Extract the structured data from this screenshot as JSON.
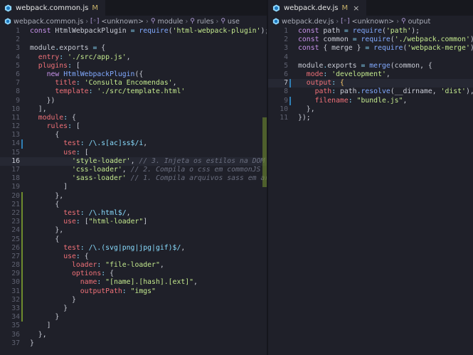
{
  "left": {
    "tab": {
      "name": "webpack.common.js",
      "status": "M",
      "close": "×"
    },
    "breadcrumb": [
      "webpack.common.js",
      "<unknown>",
      "module",
      "rules",
      "use"
    ],
    "active_line": 16,
    "lines": [
      {
        "n": "1",
        "parts": [
          [
            "k",
            "const "
          ],
          [
            "w",
            "HtmlWebpackPlugin "
          ],
          [
            "p",
            "= "
          ],
          [
            "f",
            "require"
          ],
          [
            "w",
            "("
          ],
          [
            "s",
            "'html-webpack-plugin'"
          ],
          [
            "w",
            ");"
          ]
        ]
      },
      {
        "n": "2",
        "parts": []
      },
      {
        "n": "3",
        "parts": [
          [
            "w",
            "module"
          ],
          [
            "p",
            "."
          ],
          [
            "w",
            "exports "
          ],
          [
            "p",
            "= "
          ],
          [
            "w",
            "{"
          ]
        ]
      },
      {
        "n": "4",
        "parts": [
          [
            "w",
            "  "
          ],
          [
            "pr",
            "entry"
          ],
          [
            "p",
            ": "
          ],
          [
            "s",
            "'./src/app.js'"
          ],
          [
            "w",
            ","
          ]
        ]
      },
      {
        "n": "5",
        "parts": [
          [
            "w",
            "  "
          ],
          [
            "pr",
            "plugins"
          ],
          [
            "p",
            ": "
          ],
          [
            "w",
            "["
          ]
        ]
      },
      {
        "n": "6",
        "parts": [
          [
            "w",
            "    "
          ],
          [
            "k",
            "new "
          ],
          [
            "f",
            "HtmlWebpackPlugin"
          ],
          [
            "w",
            "({"
          ]
        ]
      },
      {
        "n": "7",
        "parts": [
          [
            "w",
            "      "
          ],
          [
            "pr",
            "title"
          ],
          [
            "p",
            ": "
          ],
          [
            "s",
            "'Consulta Encomendas'"
          ],
          [
            "w",
            ","
          ]
        ]
      },
      {
        "n": "8",
        "parts": [
          [
            "w",
            "      "
          ],
          [
            "pr",
            "template"
          ],
          [
            "p",
            ": "
          ],
          [
            "s",
            "'./src/template.html'"
          ]
        ]
      },
      {
        "n": "9",
        "parts": [
          [
            "w",
            "    })"
          ]
        ]
      },
      {
        "n": "10",
        "parts": [
          [
            "w",
            "  ],"
          ]
        ]
      },
      {
        "n": "11",
        "parts": [
          [
            "w",
            "  "
          ],
          [
            "pr",
            "module"
          ],
          [
            "p",
            ": "
          ],
          [
            "w",
            "{"
          ]
        ]
      },
      {
        "n": "12",
        "parts": [
          [
            "w",
            "    "
          ],
          [
            "pr",
            "rules"
          ],
          [
            "p",
            ": "
          ],
          [
            "w",
            "["
          ]
        ]
      },
      {
        "n": "13",
        "parts": [
          [
            "w",
            "      {"
          ]
        ]
      },
      {
        "n": "14",
        "parts": [
          [
            "w",
            "        "
          ],
          [
            "pr",
            "test"
          ],
          [
            "p",
            ": "
          ],
          [
            "r",
            "/\\.s[ac]ss$/i"
          ],
          [
            "w",
            ","
          ]
        ]
      },
      {
        "n": "15",
        "parts": [
          [
            "w",
            "        "
          ],
          [
            "pr",
            "use"
          ],
          [
            "p",
            ": "
          ],
          [
            "w",
            "["
          ]
        ]
      },
      {
        "n": "16",
        "parts": [
          [
            "w",
            "          "
          ],
          [
            "s",
            "'style-loader'"
          ],
          [
            "w",
            ", "
          ],
          [
            "c",
            "// 3. Injeta os estilos na DOM"
          ]
        ]
      },
      {
        "n": "17",
        "parts": [
          [
            "w",
            "          "
          ],
          [
            "s",
            "'css-loader'"
          ],
          [
            "w",
            ", "
          ],
          [
            "c",
            "// 2. Compila o css em commonJS"
          ]
        ]
      },
      {
        "n": "18",
        "parts": [
          [
            "w",
            "          "
          ],
          [
            "s",
            "'sass-loader'"
          ],
          [
            "w",
            " "
          ],
          [
            "c",
            "// 1. Compila arquivos sass em arqui"
          ]
        ]
      },
      {
        "n": "19",
        "parts": [
          [
            "w",
            "        ]"
          ]
        ]
      },
      {
        "n": "20",
        "parts": [
          [
            "w",
            "      },"
          ]
        ]
      },
      {
        "n": "21",
        "parts": [
          [
            "w",
            "      {"
          ]
        ]
      },
      {
        "n": "22",
        "parts": [
          [
            "w",
            "        "
          ],
          [
            "pr",
            "test"
          ],
          [
            "p",
            ": "
          ],
          [
            "r",
            "/\\.html$/"
          ],
          [
            "w",
            ","
          ]
        ]
      },
      {
        "n": "23",
        "parts": [
          [
            "w",
            "        "
          ],
          [
            "pr",
            "use"
          ],
          [
            "p",
            ": "
          ],
          [
            "w",
            "["
          ],
          [
            "s",
            "\"html-loader\""
          ],
          [
            "w",
            "]"
          ]
        ]
      },
      {
        "n": "24",
        "parts": [
          [
            "w",
            "      },"
          ]
        ]
      },
      {
        "n": "25",
        "parts": [
          [
            "w",
            "      {"
          ]
        ]
      },
      {
        "n": "26",
        "parts": [
          [
            "w",
            "        "
          ],
          [
            "pr",
            "test"
          ],
          [
            "p",
            ": "
          ],
          [
            "r",
            "/\\.(svg|png|jpg|gif)$/"
          ],
          [
            "w",
            ","
          ]
        ]
      },
      {
        "n": "27",
        "parts": [
          [
            "w",
            "        "
          ],
          [
            "pr",
            "use"
          ],
          [
            "p",
            ": "
          ],
          [
            "w",
            "{"
          ]
        ]
      },
      {
        "n": "28",
        "parts": [
          [
            "w",
            "          "
          ],
          [
            "pr",
            "loader"
          ],
          [
            "p",
            ": "
          ],
          [
            "s",
            "\"file-loader\""
          ],
          [
            "w",
            ","
          ]
        ]
      },
      {
        "n": "29",
        "parts": [
          [
            "w",
            "          "
          ],
          [
            "pr",
            "options"
          ],
          [
            "p",
            ": "
          ],
          [
            "w",
            "{"
          ]
        ]
      },
      {
        "n": "30",
        "parts": [
          [
            "w",
            "            "
          ],
          [
            "pr",
            "name"
          ],
          [
            "p",
            ": "
          ],
          [
            "s",
            "\"[name].[hash].[ext]\""
          ],
          [
            "w",
            ","
          ]
        ]
      },
      {
        "n": "31",
        "parts": [
          [
            "w",
            "            "
          ],
          [
            "pr",
            "outputPath"
          ],
          [
            "p",
            ": "
          ],
          [
            "s",
            "\"imgs\""
          ]
        ]
      },
      {
        "n": "32",
        "parts": [
          [
            "w",
            "          }"
          ]
        ]
      },
      {
        "n": "33",
        "parts": [
          [
            "w",
            "        }"
          ]
        ]
      },
      {
        "n": "34",
        "parts": [
          [
            "w",
            "      }"
          ]
        ]
      },
      {
        "n": "35",
        "parts": [
          [
            "w",
            "    ]"
          ]
        ]
      },
      {
        "n": "36",
        "parts": [
          [
            "w",
            "  },"
          ]
        ]
      },
      {
        "n": "37",
        "parts": [
          [
            "w",
            "}"
          ]
        ]
      }
    ]
  },
  "right": {
    "tab": {
      "name": "webpack.dev.js",
      "status": "M",
      "close": "×"
    },
    "breadcrumb": [
      "webpack.dev.js",
      "<unknown>",
      "output"
    ],
    "active_line": 7,
    "lines": [
      {
        "n": "1",
        "parts": [
          [
            "k",
            "const "
          ],
          [
            "w",
            "path "
          ],
          [
            "p",
            "= "
          ],
          [
            "f",
            "require"
          ],
          [
            "w",
            "("
          ],
          [
            "s",
            "'path'"
          ],
          [
            "w",
            ");"
          ]
        ]
      },
      {
        "n": "2",
        "parts": [
          [
            "k",
            "const "
          ],
          [
            "w",
            "common "
          ],
          [
            "p",
            "= "
          ],
          [
            "f",
            "require"
          ],
          [
            "w",
            "("
          ],
          [
            "s",
            "'./webpack.common'"
          ],
          [
            "w",
            ");"
          ]
        ]
      },
      {
        "n": "3",
        "parts": [
          [
            "k",
            "const "
          ],
          [
            "w",
            "{ merge } "
          ],
          [
            "p",
            "= "
          ],
          [
            "f",
            "require"
          ],
          [
            "w",
            "("
          ],
          [
            "s",
            "'webpack-merge'"
          ],
          [
            "w",
            ");"
          ]
        ]
      },
      {
        "n": "4",
        "parts": []
      },
      {
        "n": "5",
        "parts": [
          [
            "w",
            "module"
          ],
          [
            "p",
            "."
          ],
          [
            "w",
            "exports "
          ],
          [
            "p",
            "= "
          ],
          [
            "f",
            "merge"
          ],
          [
            "w",
            "(common, {"
          ]
        ]
      },
      {
        "n": "6",
        "parts": [
          [
            "w",
            "  "
          ],
          [
            "pr",
            "mode"
          ],
          [
            "p",
            ": "
          ],
          [
            "s",
            "'development'"
          ],
          [
            "w",
            ","
          ]
        ]
      },
      {
        "n": "7",
        "parts": [
          [
            "w",
            "  "
          ],
          [
            "pr",
            "output"
          ],
          [
            "p",
            ": "
          ],
          [
            "y",
            "{"
          ]
        ]
      },
      {
        "n": "8",
        "parts": [
          [
            "w",
            "    "
          ],
          [
            "pr",
            "path"
          ],
          [
            "p",
            ": "
          ],
          [
            "w",
            "path"
          ],
          [
            "p",
            "."
          ],
          [
            "f",
            "resolve"
          ],
          [
            "w",
            "(__dirname, "
          ],
          [
            "s",
            "'dist'"
          ],
          [
            "w",
            "),"
          ]
        ]
      },
      {
        "n": "9",
        "parts": [
          [
            "w",
            "    "
          ],
          [
            "pr",
            "filename"
          ],
          [
            "p",
            ": "
          ],
          [
            "s",
            "\"bundle.js\""
          ],
          [
            "w",
            ","
          ]
        ]
      },
      {
        "n": "10",
        "parts": [
          [
            "w",
            "  },"
          ]
        ]
      },
      {
        "n": "11",
        "parts": [
          [
            "w",
            "});"
          ]
        ]
      }
    ]
  },
  "colors": {
    "accent": "#2f7fb5",
    "added": "#6e8b2e",
    "tab_modified": "#c8b26b"
  }
}
